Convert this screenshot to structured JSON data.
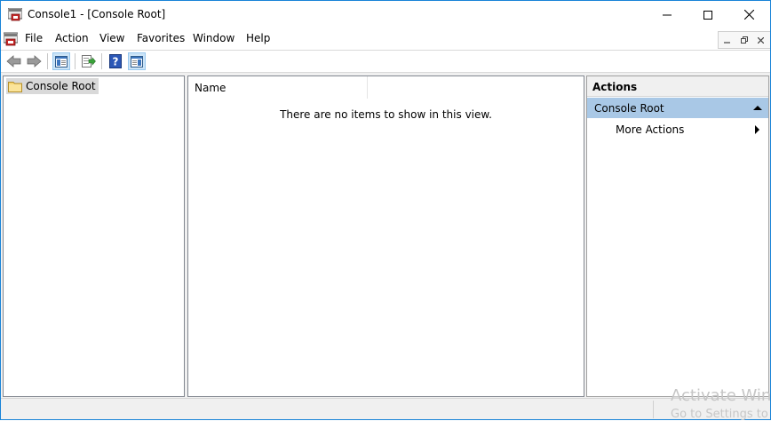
{
  "window": {
    "title": "Console1 - [Console Root]"
  },
  "menu": {
    "items": [
      "File",
      "Action",
      "View",
      "Favorites",
      "Window",
      "Help"
    ]
  },
  "toolbar": {
    "buttons": [
      "back-arrow-icon",
      "forward-arrow-icon",
      "show-hide-console-tree-icon",
      "export-list-icon",
      "help-icon",
      "show-hide-action-pane-icon"
    ]
  },
  "tree": {
    "root_label": "Console Root"
  },
  "list": {
    "column_name": "Name",
    "empty_message": "There are no items to show in this view."
  },
  "actions": {
    "title": "Actions",
    "group_label": "Console Root",
    "item_more": "More Actions"
  },
  "watermark": {
    "line1": "Activate Win",
    "line2": "Go to Settings to"
  },
  "colors": {
    "accent": "#1883d7",
    "selection": "#a9c8e6",
    "tree_selected": "#d9d9d9"
  }
}
